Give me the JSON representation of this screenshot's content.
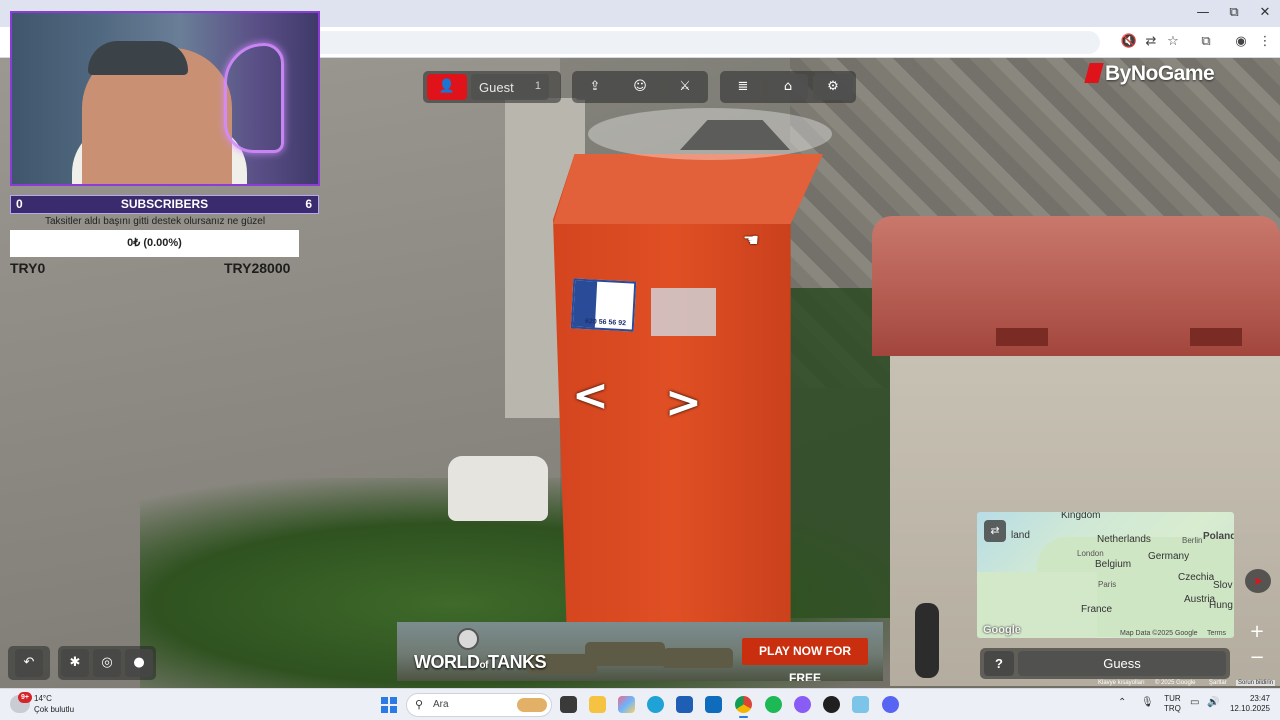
{
  "browser": {
    "minimize": "—",
    "maximize": "⧉",
    "close": "✕"
  },
  "game": {
    "player": {
      "name": "Guest",
      "count": "1"
    },
    "brand": "ByNoGame",
    "guess_label": "Guess",
    "help_label": "?"
  },
  "stream": {
    "subs_left": "0",
    "subs_label": "SUBSCRIBERS",
    "subs_right": "6",
    "donation_message": "Taksitler aldı başını gitti destek olursanız ne güzel",
    "goal_progress": "0₺ (0.00%)",
    "goal_min": "TRY0",
    "goal_max": "TRY28000"
  },
  "minimap": {
    "labels": {
      "kingdom": "Kingdom",
      "land": "land",
      "netherlands": "Netherlands",
      "berlin": "Berlin",
      "poland": "Poland",
      "london": "London",
      "germany": "Germany",
      "belgium": "Belgium",
      "paris": "Paris",
      "czechia": "Czechia",
      "austria": "Austria",
      "france": "France",
      "slov": "Slov",
      "hung": "Hung"
    },
    "google": "Google",
    "map_data": "Map Data ©2025 Google",
    "terms": "Terms"
  },
  "gm_footer": {
    "shortcuts": "Klavye kısayolları",
    "copyright": "© 2025 Google",
    "terms": "Şartlar",
    "report": "Sorun bildirin"
  },
  "ad": {
    "brand_left": "WORLD",
    "brand_of": "of",
    "brand_right": "TANKS",
    "cta": "PLAY NOW FOR FREE"
  },
  "taskbar": {
    "weather_badge": "9+",
    "temperature": "14°C",
    "weather_desc": "Çok bulutlu",
    "search_placeholder": "Ara",
    "lang_line1": "TUR",
    "lang_line2": "TRQ",
    "time": "23:47",
    "date": "12.10.2025"
  },
  "colors": {
    "accent_red": "#e0131b",
    "stream_purple": "#8a3bd8",
    "ad_cta": "#c92f0f"
  }
}
